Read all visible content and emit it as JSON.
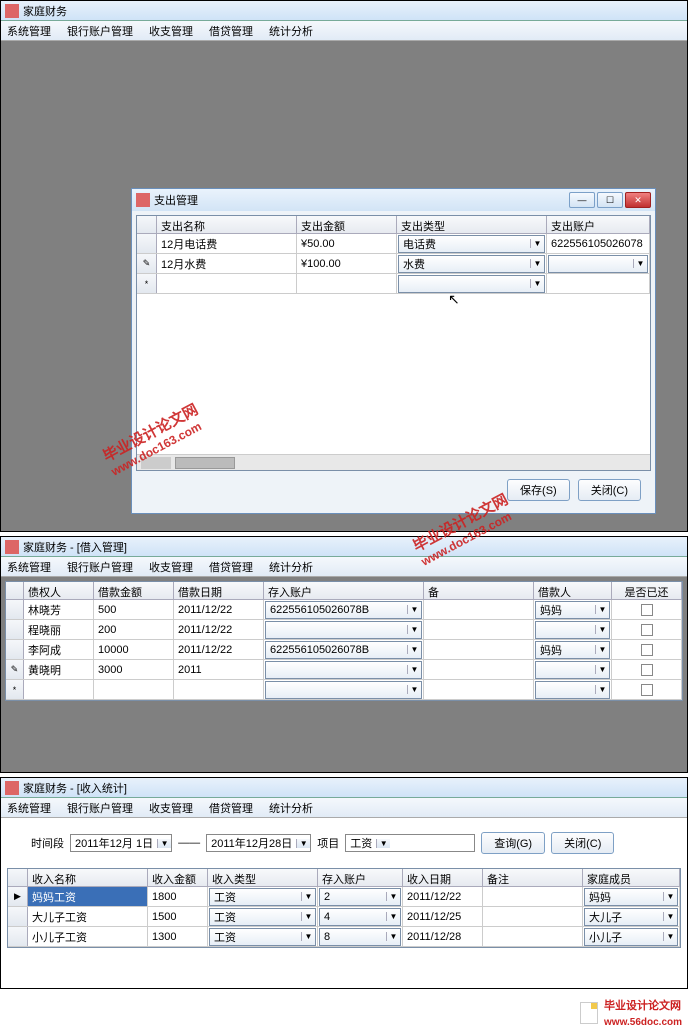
{
  "app_title": "家庭财务",
  "menu": {
    "system": "系统管理",
    "bank": "银行账户管理",
    "income": "收支管理",
    "loan": "借贷管理",
    "stats": "统计分析"
  },
  "expense_dialog": {
    "title": "支出管理",
    "cols": {
      "name": "支出名称",
      "amount": "支出金额",
      "type": "支出类型",
      "account": "支出账户"
    },
    "rows": [
      {
        "name": "12月电话费",
        "amount": "¥50.00",
        "type": "电话费",
        "account": "622556105026078"
      },
      {
        "name": "12月水费",
        "amount": "¥100.00",
        "type": "水费",
        "account": ""
      }
    ],
    "save_btn": "保存(S)",
    "close_btn": "关闭(C)"
  },
  "loan": {
    "title": "家庭财务 - [借入管理]",
    "cols": {
      "creditor": "债权人",
      "amount": "借款金额",
      "date": "借款日期",
      "account": "存入账户",
      "note": "备 ",
      "borrower": "借款人",
      "repaid": "是否已还"
    },
    "rows": [
      {
        "creditor": "林晓芳",
        "amount": "500",
        "date": "2011/12/22",
        "account": "622556105026078B",
        "borrower": "妈妈"
      },
      {
        "creditor": "程晓丽",
        "amount": "200",
        "date": "2011/12/22",
        "account": "",
        "borrower": ""
      },
      {
        "creditor": "李阿成",
        "amount": "10000",
        "date": "2011/12/22",
        "account": "622556105026078B",
        "borrower": "妈妈"
      },
      {
        "creditor": "黄晓明",
        "amount": "3000",
        "date": "2011",
        "account": "",
        "borrower": ""
      }
    ]
  },
  "stats": {
    "title": "家庭财务 - [收入统计]",
    "period_label": "时间段",
    "date_from": "2011年12月 1日",
    "date_to": "2011年12月28日",
    "sep": "——",
    "item_label": "项目",
    "item_value": "工资",
    "query_btn": "查询(G)",
    "close_btn": "关闭(C)",
    "cols": {
      "name": "收入名称",
      "amount": "收入金额",
      "type": "收入类型",
      "account": "存入账户",
      "date": "收入日期",
      "note": "备注",
      "member": "家庭成员"
    },
    "rows": [
      {
        "name": "妈妈工资",
        "amount": "1800",
        "type": "工资",
        "account": "2",
        "date": "2011/12/22",
        "note": "",
        "member": "妈妈"
      },
      {
        "name": "大儿子工资",
        "amount": "1500",
        "type": "工资",
        "account": "4",
        "date": "2011/12/25",
        "note": "",
        "member": "大儿子"
      },
      {
        "name": "小儿子工资",
        "amount": "1300",
        "type": "工资",
        "account": "8",
        "date": "2011/12/28",
        "note": "",
        "member": "小儿子"
      }
    ]
  },
  "watermark": {
    "zh": "毕业设计论文网",
    "url1": "www.doc163.com",
    "url2": "www.56doc.com"
  }
}
